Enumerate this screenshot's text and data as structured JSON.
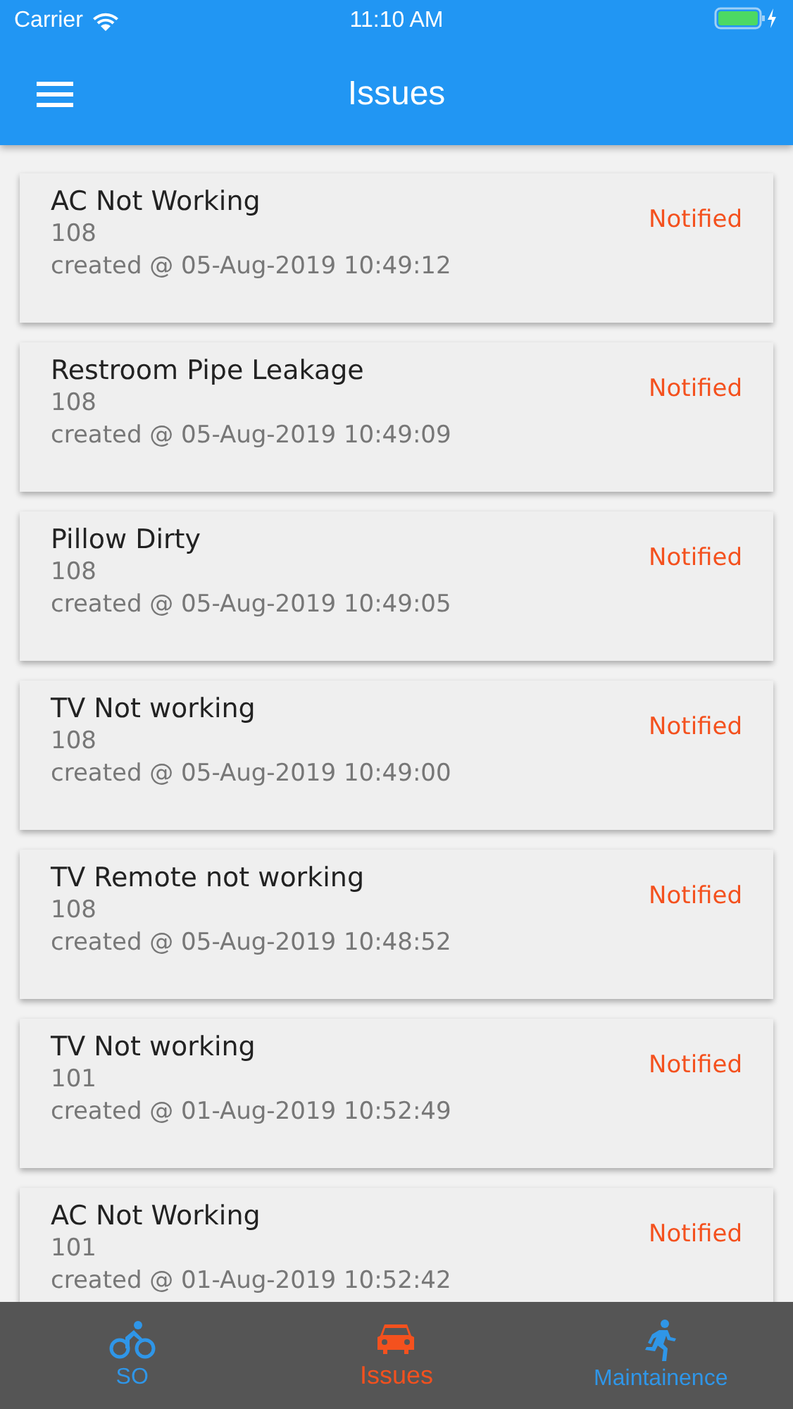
{
  "status_bar": {
    "carrier": "Carrier",
    "time": "11:10 AM"
  },
  "app_bar": {
    "title": "Issues"
  },
  "issues": [
    {
      "title": "AC Not Working",
      "room": "108",
      "created": "created @ 05-Aug-2019 10:49:12",
      "status": "Notified"
    },
    {
      "title": "Restroom Pipe Leakage",
      "room": "108",
      "created": "created @ 05-Aug-2019 10:49:09",
      "status": "Notified"
    },
    {
      "title": "Pillow Dirty",
      "room": "108",
      "created": "created @ 05-Aug-2019 10:49:05",
      "status": "Notified"
    },
    {
      "title": "TV Not working",
      "room": "108",
      "created": "created @ 05-Aug-2019 10:49:00",
      "status": "Notified"
    },
    {
      "title": "TV Remote not working",
      "room": "108",
      "created": "created @ 05-Aug-2019 10:48:52",
      "status": "Notified"
    },
    {
      "title": "TV Not working",
      "room": "101",
      "created": "created @ 01-Aug-2019 10:52:49",
      "status": "Notified"
    },
    {
      "title": "AC Not Working",
      "room": "101",
      "created": "created @ 01-Aug-2019 10:52:42",
      "status": "Notified"
    }
  ],
  "tabs": [
    {
      "kind": "bike",
      "label": "SO",
      "selected": false
    },
    {
      "kind": "car",
      "label": "Issues",
      "selected": true
    },
    {
      "kind": "run",
      "label": "Maintainence",
      "selected": false
    }
  ]
}
